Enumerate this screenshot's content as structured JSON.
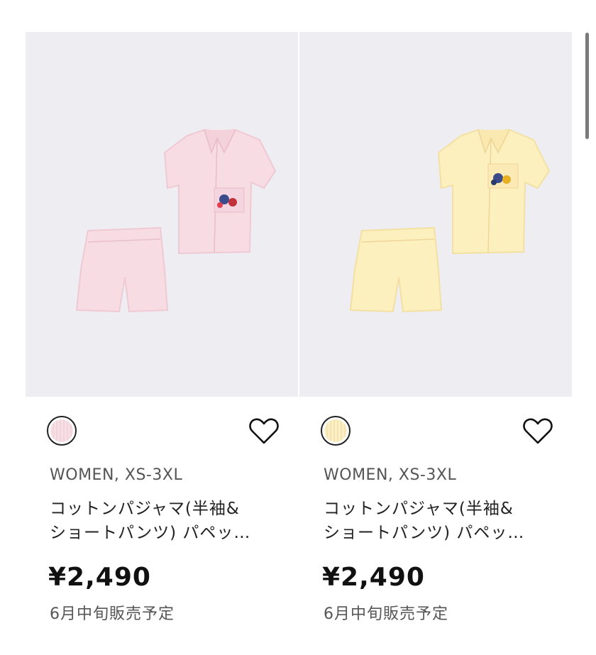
{
  "products": [
    {
      "meta": "WOMEN, XS-3XL",
      "name_line1": "コットンパジャマ(半袖&",
      "name_line2": "ショートパンツ) パペッ…",
      "price": "¥2,490",
      "release": "6月中旬販売予定",
      "swatch_color": "#f7dfe6",
      "garment_color": "#f7dce4",
      "garment_shade": "#efc9d4",
      "favorite_icon": "heart-outline-icon"
    },
    {
      "meta": "WOMEN, XS-3XL",
      "name_line1": "コットンパジャマ(半袖&",
      "name_line2": "ショートパンツ) パペッ…",
      "price": "¥2,490",
      "release": "6月中旬販売予定",
      "swatch_color": "#fbefc6",
      "garment_color": "#fdf0bf",
      "garment_shade": "#f3e0a2",
      "favorite_icon": "heart-outline-icon"
    }
  ],
  "colors": {
    "image_background": "#eeedf2",
    "text_primary": "#222222",
    "text_secondary": "#555555"
  }
}
